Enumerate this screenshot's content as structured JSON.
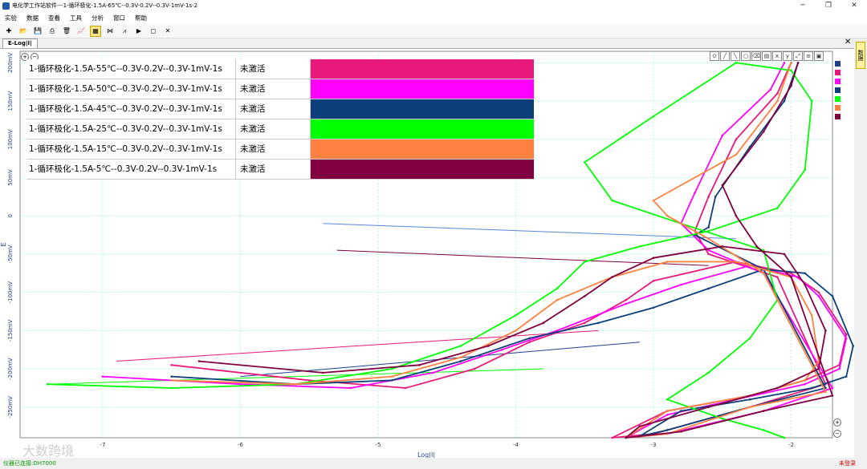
{
  "window": {
    "title": "电化学工作站软件---1-循环极化-1.5A-65℃--0.3V-0.2V--0.3V-1mV-1s-2"
  },
  "menu": [
    "实验",
    "数据",
    "查看",
    "工具",
    "分析",
    "窗口",
    "帮助"
  ],
  "toolbar": [
    "new-icon",
    "open-icon",
    "save-icon",
    "print-icon",
    "delete-icon",
    "chart-icon",
    "table-icon",
    "compare-icon",
    "filter-icon",
    "run-icon",
    "stop-icon",
    "close-icon"
  ],
  "tab": {
    "label": "E-Log|I|"
  },
  "right_panel": {
    "label": "数据"
  },
  "status": {
    "left": "仪器已连接:DH7000",
    "right": "未登录"
  },
  "watermark": "大数跨境",
  "legend": [
    {
      "name": "1-循环极化-1.5A-55℃--0.3V-0.2V--0.3V-1mV-1s",
      "status": "未激活",
      "color": "#e8197a"
    },
    {
      "name": "1-循环极化-1.5A-50℃--0.3V-0.2V--0.3V-1mV-1s",
      "status": "未激活",
      "color": "#ff00ff"
    },
    {
      "name": "1-循环极化-1.5A-45℃--0.3V-0.2V--0.3V-1mV-1s",
      "status": "未激活",
      "color": "#0c3f7a"
    },
    {
      "name": "1-循环极化-1.5A-25℃--0.3V-0.2V--0.3V-1mV-1s",
      "status": "未激活",
      "color": "#00ff00"
    },
    {
      "name": "1-循环极化-1.5A-15℃--0.3V-0.2V--0.3V-1mV-1s",
      "status": "未激活",
      "color": "#ff8040"
    },
    {
      "name": "1-循环极化-1.5A-5℃--0.3V-0.2V--0.3V-1mV-1s",
      "status": "未激活",
      "color": "#800040"
    }
  ],
  "swatches": [
    "#1f3f8f",
    "#e8197a",
    "#ff00ff",
    "#0c3f7a",
    "#00ff00",
    "#ff8040",
    "#800040"
  ],
  "chart_data": {
    "type": "line",
    "xlabel": "Log|I|",
    "ylabel": "E",
    "xlim": [
      -7.6,
      -1.7
    ],
    "ylim": [
      -290,
      215
    ],
    "xticks": [
      -7,
      -6,
      -5,
      -4,
      -3,
      -2
    ],
    "yticks": [
      -250,
      -200,
      -150,
      -100,
      -50,
      0,
      50,
      100,
      150,
      200
    ],
    "ytick_labels": [
      "-250mV",
      "-200mV",
      "-150mV",
      "-100mV",
      "-50mV",
      "0",
      "50mV",
      "100mV",
      "150mV",
      "200mV"
    ],
    "grid": true,
    "series": [
      {
        "name": "1-循环极化-1.5A-55℃--0.3V-0.2V--0.3V-1mV-1s",
        "color": "#e8197a",
        "x": [
          -6.5,
          -5.5,
          -4.8,
          -4.3,
          -3.9,
          -3.5,
          -3.2,
          -3.0,
          -2.4,
          -2.0,
          -1.8,
          -1.6,
          -1.65,
          -1.9,
          -2.3,
          -2.9,
          -3.3,
          -3.0,
          -2.3,
          -1.75,
          -2.1,
          -2.6,
          -2.7,
          -2.6,
          -2.4,
          -2.1,
          -2.0
        ],
        "y": [
          -195,
          -215,
          -225,
          -200,
          -165,
          -140,
          -110,
          -85,
          -60,
          -75,
          -100,
          -155,
          -195,
          -215,
          -235,
          -255,
          -290,
          -285,
          -250,
          -220,
          -80,
          -50,
          -20,
          25,
          100,
          160,
          200
        ]
      },
      {
        "name": "1-循环极化-1.5A-50℃--0.3V-0.2V--0.3V-1mV-1s",
        "color": "#ff00ff",
        "x": [
          -7.0,
          -6.0,
          -5.2,
          -4.6,
          -4.1,
          -3.7,
          -3.2,
          -2.8,
          -2.3,
          -1.95,
          -1.8,
          -1.6,
          -1.65,
          -1.9,
          -2.4,
          -2.9,
          -3.2,
          -2.9,
          -2.2,
          -1.7,
          -2.2,
          -2.6,
          -2.8,
          -2.7,
          -2.5,
          -2.15,
          -2.05
        ],
        "y": [
          -210,
          -220,
          -225,
          -205,
          -175,
          -150,
          -115,
          -90,
          -65,
          -80,
          -105,
          -160,
          -200,
          -220,
          -240,
          -260,
          -290,
          -285,
          -255,
          -225,
          -75,
          -45,
          -10,
          30,
          105,
          165,
          200
        ]
      },
      {
        "name": "1-循环极化-1.5A-45℃--0.3V-0.2V--0.3V-1mV-1s",
        "color": "#0c3f7a",
        "x": [
          -6.5,
          -5.6,
          -4.9,
          -4.4,
          -3.9,
          -3.4,
          -3.0,
          -2.6,
          -2.2,
          -1.9,
          -1.7,
          -1.55,
          -1.6,
          -1.85,
          -2.3,
          -2.8,
          -3.1,
          -2.9,
          -2.3,
          -1.75,
          -2.2,
          -2.7,
          -2.6,
          -2.55,
          -2.3,
          -2.05,
          -1.95
        ],
        "y": [
          -210,
          -220,
          -215,
          -190,
          -160,
          -140,
          -120,
          -95,
          -70,
          -75,
          -105,
          -170,
          -210,
          -225,
          -240,
          -255,
          -288,
          -280,
          -250,
          -225,
          -70,
          -25,
          -15,
          25,
          90,
          150,
          200
        ]
      },
      {
        "name": "1-循环极化-1.5A-25℃--0.3V-0.2V--0.3V-1mV-1s",
        "color": "#00ff00",
        "x": [
          -7.4,
          -6.5,
          -5.6,
          -4.9,
          -4.4,
          -4.0,
          -3.7,
          -3.5,
          -3.1,
          -2.6,
          -2.1,
          -1.9,
          -1.85,
          -2.0,
          -2.4,
          -3.0,
          -3.5,
          -3.3,
          -2.8,
          -2.2,
          -2.1,
          -2.3,
          -2.6,
          -2.9,
          -2.5,
          -2.2,
          -2.05
        ],
        "y": [
          -220,
          -225,
          -220,
          -200,
          -170,
          -130,
          -95,
          -60,
          -40,
          -20,
          10,
          60,
          150,
          190,
          200,
          130,
          70,
          20,
          -10,
          -45,
          -110,
          -160,
          -205,
          -240,
          -265,
          -280,
          -290
        ]
      },
      {
        "name": "1-循环极化-1.5A-15℃--0.3V-0.2V--0.3V-1mV-1s",
        "color": "#ff8040",
        "x": [
          -6.5,
          -5.6,
          -4.9,
          -4.4,
          -4.0,
          -3.7,
          -3.3,
          -2.9,
          -2.4,
          -2.0,
          -1.85,
          -1.8,
          -1.9,
          -2.3,
          -2.9,
          -3.2,
          -2.9,
          -2.3,
          -1.75,
          -2.2,
          -2.6,
          -2.9,
          -3.0,
          -2.4,
          -2.1,
          -2.0
        ],
        "y": [
          -215,
          -220,
          -210,
          -185,
          -150,
          -110,
          -80,
          -60,
          -60,
          -80,
          -130,
          -190,
          -215,
          -235,
          -255,
          -290,
          -285,
          -250,
          -230,
          -75,
          -30,
          0,
          20,
          80,
          150,
          200
        ]
      },
      {
        "name": "1-循环极化-1.5A-5℃--0.3V-0.2V--0.3V-1mV-1s",
        "color": "#800040",
        "x": [
          -6.3,
          -5.4,
          -4.7,
          -4.2,
          -3.8,
          -3.5,
          -3.3,
          -3.0,
          -2.5,
          -2.05,
          -1.9,
          -1.75,
          -1.8,
          -2.1,
          -2.6,
          -3.1,
          -3.2,
          -2.8,
          -2.2,
          -1.7,
          -2.0,
          -2.25,
          -2.4,
          -2.5,
          -2.2,
          -2.0,
          -1.95
        ],
        "y": [
          -190,
          -205,
          -195,
          -170,
          -140,
          -105,
          -80,
          -55,
          -40,
          -50,
          -90,
          -150,
          -200,
          -225,
          -250,
          -275,
          -290,
          -282,
          -255,
          -235,
          -80,
          -40,
          0,
          40,
          110,
          170,
          200
        ]
      }
    ],
    "reverse_lines": [
      {
        "color": "#1f3f8f",
        "x0": -6.0,
        "y0": -210,
        "x1": -3.1,
        "y1": -165
      },
      {
        "color": "#e8197a",
        "x0": -6.9,
        "y0": -190,
        "x1": -3.4,
        "y1": -150
      },
      {
        "color": "#00ff00",
        "x0": -7.4,
        "y0": -220,
        "x1": -3.8,
        "y1": -200
      },
      {
        "color": "#5588dd",
        "x0": -5.4,
        "y0": -10,
        "x1": -2.4,
        "y1": -30
      },
      {
        "color": "#800040",
        "x0": -5.3,
        "y0": -45,
        "x1": -2.6,
        "y1": -65
      }
    ]
  }
}
